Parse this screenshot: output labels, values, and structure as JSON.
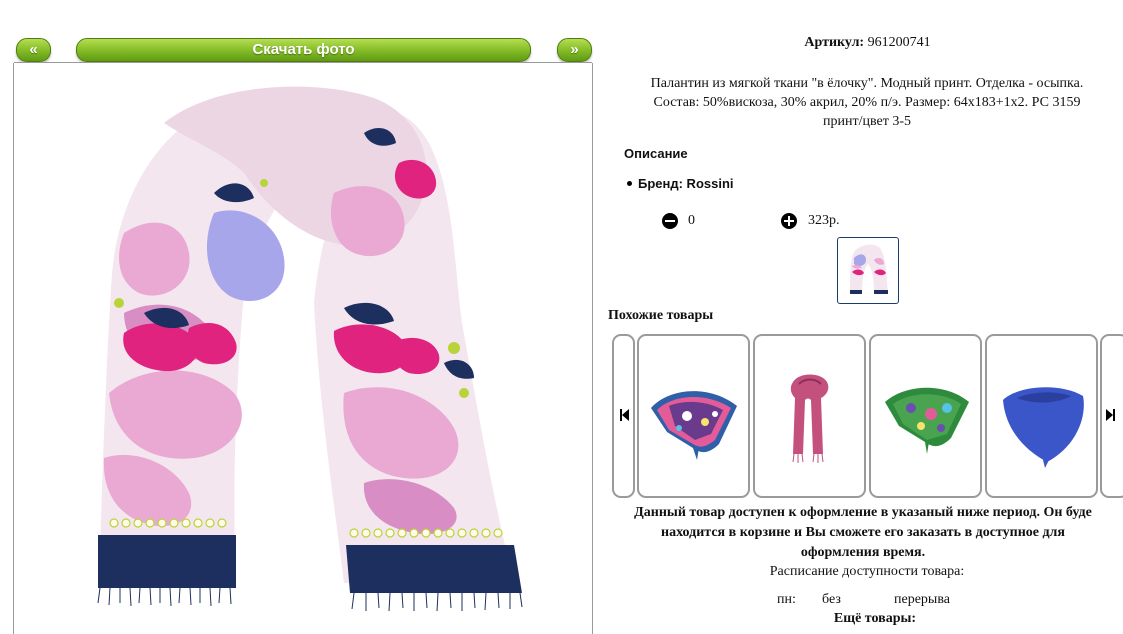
{
  "photo_nav": {
    "prev_label": "«",
    "download_label": "Скачать фото",
    "next_label": "»"
  },
  "product": {
    "article_label": "Артикул:",
    "article_value": "961200741",
    "description_lines": [
      "Палантин из мягкой ткани \"в ёлочку\". Модный принт. Отделка - осыпка.",
      "Состав: 50%вискоза, 30% акрил, 20% п/э. Размер: 64х183+1х2. РС 3159",
      "принт/цвет 3-5"
    ],
    "description_heading": "Описание",
    "brand_text": "Бренд: Rossini",
    "quantity": "0",
    "price": "323р."
  },
  "similar": {
    "heading": "Похожие товары",
    "items": [
      {
        "name": "scarf-blue-patterned"
      },
      {
        "name": "scarf-pink-long"
      },
      {
        "name": "scarf-green-floral"
      },
      {
        "name": "scarf-blue-plain"
      }
    ]
  },
  "availability": {
    "notice_lines": [
      "Данный товар доступен к оформление в указаный ниже период. Он буде",
      "находится в корзине и Вы сможете его заказать в доступное для",
      "оформления время."
    ],
    "schedule_title": "Расписание доступности товара:",
    "schedule": [
      {
        "day": "пн:",
        "from": "без",
        "to": "перерыва"
      }
    ],
    "more_heading": "Ещё товары:"
  },
  "colors": {
    "button_green": "#8ac12b",
    "scarf_pink": "#e9a9d3",
    "scarf_navy": "#1d2f5e",
    "scarf_magenta": "#e0237e",
    "scarf_lime": "#b9d33a",
    "scarf_background": "#f4e6ef"
  }
}
